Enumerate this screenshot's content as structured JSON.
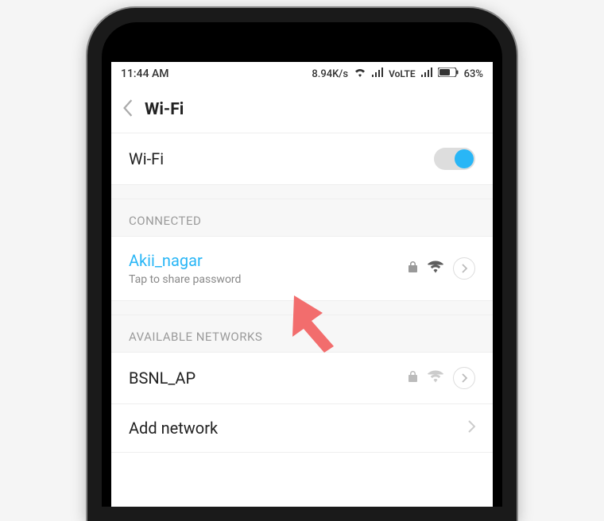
{
  "statusbar": {
    "time": "11:44 AM",
    "speed": "8.94K/s",
    "volte": "VoLTE",
    "battery_pct": "63%"
  },
  "header": {
    "title": "Wi-Fi"
  },
  "wifi_toggle": {
    "label": "Wi-Fi",
    "on": true
  },
  "sections": {
    "connected_header": "CONNECTED",
    "available_header": "AVAILABLE NETWORKS"
  },
  "connected": {
    "ssid": "Akii_nagar",
    "subtitle": "Tap to share password",
    "secured": true
  },
  "available": [
    {
      "ssid": "BSNL_AP",
      "secured": true,
      "weak": true
    }
  ],
  "add_network": {
    "label": "Add network"
  }
}
